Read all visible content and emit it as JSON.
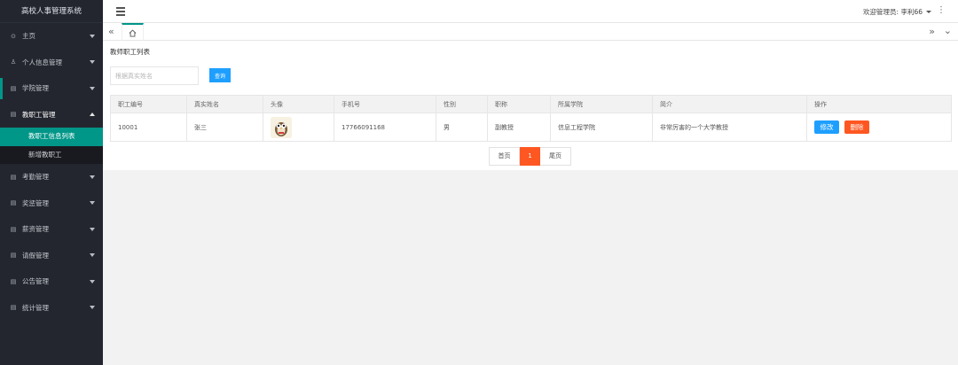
{
  "app": {
    "title": "高校人事管理系统"
  },
  "sidebar": {
    "items": [
      {
        "label": "主页",
        "icon": "home-icon",
        "glyph": "⊙"
      },
      {
        "label": "个人信息管理",
        "icon": "user-icon",
        "glyph": "♙"
      },
      {
        "label": "学院管理",
        "icon": "doc-icon",
        "glyph": "▤"
      },
      {
        "label": "教职工管理",
        "icon": "doc-icon",
        "glyph": "▤"
      }
    ],
    "subitems": [
      {
        "label": "教职工信息列表"
      },
      {
        "label": "新增教职工"
      }
    ],
    "items_after": [
      {
        "label": "考勤管理"
      },
      {
        "label": "奖惩管理"
      },
      {
        "label": "薪资管理"
      },
      {
        "label": "请假管理"
      },
      {
        "label": "公告管理"
      },
      {
        "label": "统计管理"
      }
    ]
  },
  "header": {
    "admin_label": "欢迎管理员: 李利66"
  },
  "content": {
    "page_title": "教师职工列表",
    "search_placeholder": "根据真实姓名",
    "query_button": "查询",
    "table": {
      "columns": [
        "职工编号",
        "真实姓名",
        "头像",
        "手机号",
        "性别",
        "职称",
        "所属学院",
        "简介",
        "操作"
      ],
      "rows": [
        {
          "id": "10001",
          "name": "张三",
          "phone": "17766091168",
          "gender": "男",
          "title": "副教授",
          "college": "信息工程学院",
          "intro": "非常厉害的一个大学教授",
          "edit": "修改",
          "delete": "删除"
        }
      ]
    },
    "pager": {
      "first": "首页",
      "current": "1",
      "last": "尾页"
    }
  },
  "colors": {
    "sidebar_bg": "#23262e",
    "accent_green": "#009688",
    "primary_blue": "#1e9fff",
    "danger_orange": "#ff5722"
  }
}
